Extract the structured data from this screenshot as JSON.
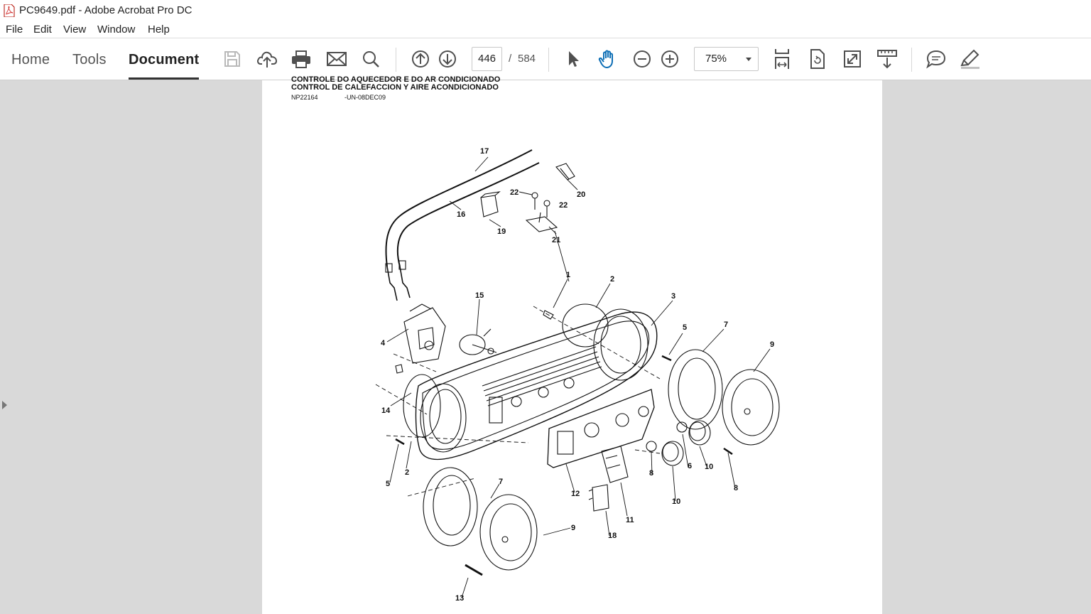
{
  "window": {
    "title": "PC9649.pdf - Adobe Acrobat Pro DC"
  },
  "menu": {
    "items": [
      "File",
      "Edit",
      "View",
      "Window",
      "Help"
    ]
  },
  "nav": {
    "tabs": [
      "Home",
      "Tools",
      "Document"
    ],
    "active": "Document"
  },
  "toolbar": {
    "icons": [
      "save-icon",
      "upload-cloud-icon",
      "print-icon",
      "email-icon",
      "search-icon",
      "previous-page-icon",
      "next-page-icon",
      "select-arrow-icon",
      "hand-icon",
      "zoom-out-icon",
      "zoom-in-icon",
      "fit-page-icon",
      "rotate-icon",
      "full-screen-icon",
      "scroll-mode-icon",
      "comment-icon",
      "highlight-pen-icon"
    ],
    "current_page": "446",
    "page_separator": "/",
    "total_pages": "584",
    "zoom": "75%"
  },
  "document": {
    "heading_partial": "CONTROLE DO AQUECEDOR E DO AR CONDICIONADO",
    "heading": "CONTROL DE CALEFACCION Y AIRE ACONDICIONADO",
    "ref_code": "NP22164",
    "ref_date": "-UN-08DEC09",
    "callouts": [
      "17",
      "16",
      "19",
      "20",
      "22",
      "22",
      "21",
      "1",
      "2",
      "3",
      "15",
      "4",
      "5",
      "7",
      "9",
      "14",
      "2",
      "5",
      "6",
      "10",
      "8",
      "8",
      "12",
      "11",
      "10",
      "7",
      "9",
      "18",
      "13"
    ]
  },
  "colors": {
    "accent": "#0d6eb5",
    "workspace": "#d9d9d9"
  }
}
